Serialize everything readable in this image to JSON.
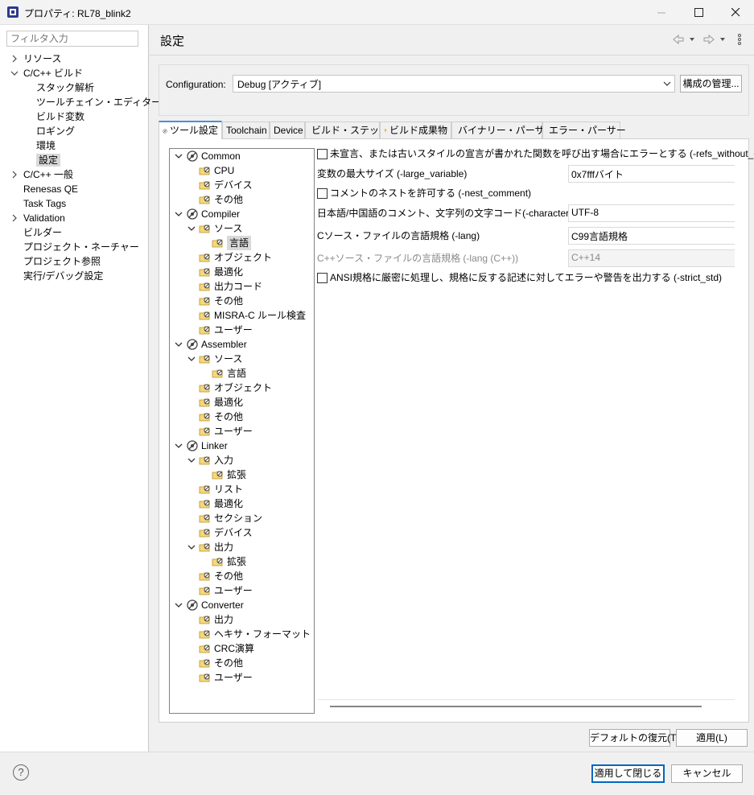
{
  "window": {
    "title": "プロパティ: RL78_blink2",
    "minimize_label": "—",
    "maximize_label": "☐",
    "close_label": "✕"
  },
  "filter": {
    "placeholder": "フィルタ入力"
  },
  "nav": [
    {
      "label": "リソース",
      "level": 0,
      "chevron": "right"
    },
    {
      "label": "C/C++ ビルド",
      "level": 0,
      "chevron": "down"
    },
    {
      "label": "スタック解析",
      "level": 1
    },
    {
      "label": "ツールチェイン・エディター",
      "level": 1
    },
    {
      "label": "ビルド変数",
      "level": 1
    },
    {
      "label": "ロギング",
      "level": 1
    },
    {
      "label": "環境",
      "level": 1
    },
    {
      "label": "設定",
      "level": 1,
      "selected": true
    },
    {
      "label": "C/C++ 一般",
      "level": 0,
      "chevron": "right"
    },
    {
      "label": "Renesas QE",
      "level": 0
    },
    {
      "label": "Task Tags",
      "level": 0
    },
    {
      "label": "Validation",
      "level": 0,
      "chevron": "right"
    },
    {
      "label": "ビルダー",
      "level": 0
    },
    {
      "label": "プロジェクト・ネーチャー",
      "level": 0
    },
    {
      "label": "プロジェクト参照",
      "level": 0
    },
    {
      "label": "実行/デバッグ設定",
      "level": 0
    }
  ],
  "header": {
    "title": "設定"
  },
  "config": {
    "label": "Configuration:",
    "value": "Debug  [アクティブ]",
    "manage_button": "構成の管理..."
  },
  "tabs": [
    {
      "label": "ツール設定",
      "icon": "tool-settings-icon",
      "active": true
    },
    {
      "label": "Toolchain"
    },
    {
      "label": "Device"
    },
    {
      "label": "ビルド・ステップ",
      "icon": "build-steps-icon"
    },
    {
      "label": "ビルド成果物",
      "icon": "trophy-icon"
    },
    {
      "label": "バイナリー・パーサー",
      "icon": "binary-parser-icon"
    },
    {
      "label": "エラー・パーサー",
      "icon": "error-parser-icon"
    }
  ],
  "tree": [
    {
      "label": "Common",
      "level": 0,
      "expanded": true,
      "kind": "tool"
    },
    {
      "label": "CPU",
      "level": 1,
      "kind": "folder"
    },
    {
      "label": "デバイス",
      "level": 1,
      "kind": "folder"
    },
    {
      "label": "その他",
      "level": 1,
      "kind": "folder"
    },
    {
      "label": "Compiler",
      "level": 0,
      "expanded": true,
      "kind": "tool"
    },
    {
      "label": "ソース",
      "level": 1,
      "expanded": true,
      "kind": "folder"
    },
    {
      "label": "言語",
      "level": 2,
      "kind": "folder",
      "selected": true
    },
    {
      "label": "オブジェクト",
      "level": 1,
      "kind": "folder"
    },
    {
      "label": "最適化",
      "level": 1,
      "kind": "folder"
    },
    {
      "label": "出力コード",
      "level": 1,
      "kind": "folder"
    },
    {
      "label": "その他",
      "level": 1,
      "kind": "folder"
    },
    {
      "label": "MISRA-C ルール検査",
      "level": 1,
      "kind": "folder"
    },
    {
      "label": "ユーザー",
      "level": 1,
      "kind": "folder"
    },
    {
      "label": "Assembler",
      "level": 0,
      "expanded": true,
      "kind": "tool"
    },
    {
      "label": "ソース",
      "level": 1,
      "expanded": true,
      "kind": "folder"
    },
    {
      "label": "言語",
      "level": 2,
      "kind": "folder"
    },
    {
      "label": "オブジェクト",
      "level": 1,
      "kind": "folder"
    },
    {
      "label": "最適化",
      "level": 1,
      "kind": "folder"
    },
    {
      "label": "その他",
      "level": 1,
      "kind": "folder"
    },
    {
      "label": "ユーザー",
      "level": 1,
      "kind": "folder"
    },
    {
      "label": "Linker",
      "level": 0,
      "expanded": true,
      "kind": "tool"
    },
    {
      "label": "入力",
      "level": 1,
      "expanded": true,
      "kind": "folder"
    },
    {
      "label": "拡張",
      "level": 2,
      "kind": "folder"
    },
    {
      "label": "リスト",
      "level": 1,
      "kind": "folder"
    },
    {
      "label": "最適化",
      "level": 1,
      "kind": "folder"
    },
    {
      "label": "セクション",
      "level": 1,
      "kind": "folder"
    },
    {
      "label": "デバイス",
      "level": 1,
      "kind": "folder"
    },
    {
      "label": "出力",
      "level": 1,
      "expanded": true,
      "kind": "folder"
    },
    {
      "label": "拡張",
      "level": 2,
      "kind": "folder"
    },
    {
      "label": "その他",
      "level": 1,
      "kind": "folder"
    },
    {
      "label": "ユーザー",
      "level": 1,
      "kind": "folder"
    },
    {
      "label": "Converter",
      "level": 0,
      "expanded": true,
      "kind": "tool"
    },
    {
      "label": "出力",
      "level": 1,
      "kind": "folder"
    },
    {
      "label": "ヘキサ・フォーマット",
      "level": 1,
      "kind": "folder"
    },
    {
      "label": "CRC演算",
      "level": 1,
      "kind": "folder"
    },
    {
      "label": "その他",
      "level": 1,
      "kind": "folder"
    },
    {
      "label": "ユーザー",
      "level": 1,
      "kind": "folder"
    }
  ],
  "options": {
    "refs_without_declaration": {
      "label": "未宣言、または古いスタイルの宣言が書かれた関数を呼び出す場合にエラーとする (-refs_without_declarat",
      "checked": false
    },
    "large_variable": {
      "label": "変数の最大サイズ (-large_variable)",
      "value": "0x7fffバイト"
    },
    "nest_comment": {
      "label": "コメントのネストを許可する (-nest_comment)",
      "checked": false
    },
    "character_set": {
      "label": "日本語/中国語のコメント、文字列の文字コード(-character_set)",
      "value": "UTF-8"
    },
    "lang": {
      "label": "Cソース・ファイルの言語規格 (-lang)",
      "value": "C99言語規格"
    },
    "lang_cpp": {
      "label": "C++ソース・ファイルの言語規格 (-lang (C++))",
      "value": "C++14",
      "disabled": true
    },
    "strict_std": {
      "label": "ANSI規格に厳密に処理し、規格に反する記述に対してエラーや警告を出力する (-strict_std)",
      "checked": false
    }
  },
  "buttons": {
    "restore_defaults": "デフォルトの復元(T)",
    "apply": "適用(L)",
    "apply_close": "適用して閉じる",
    "cancel": "キャンセル",
    "help": "?"
  }
}
